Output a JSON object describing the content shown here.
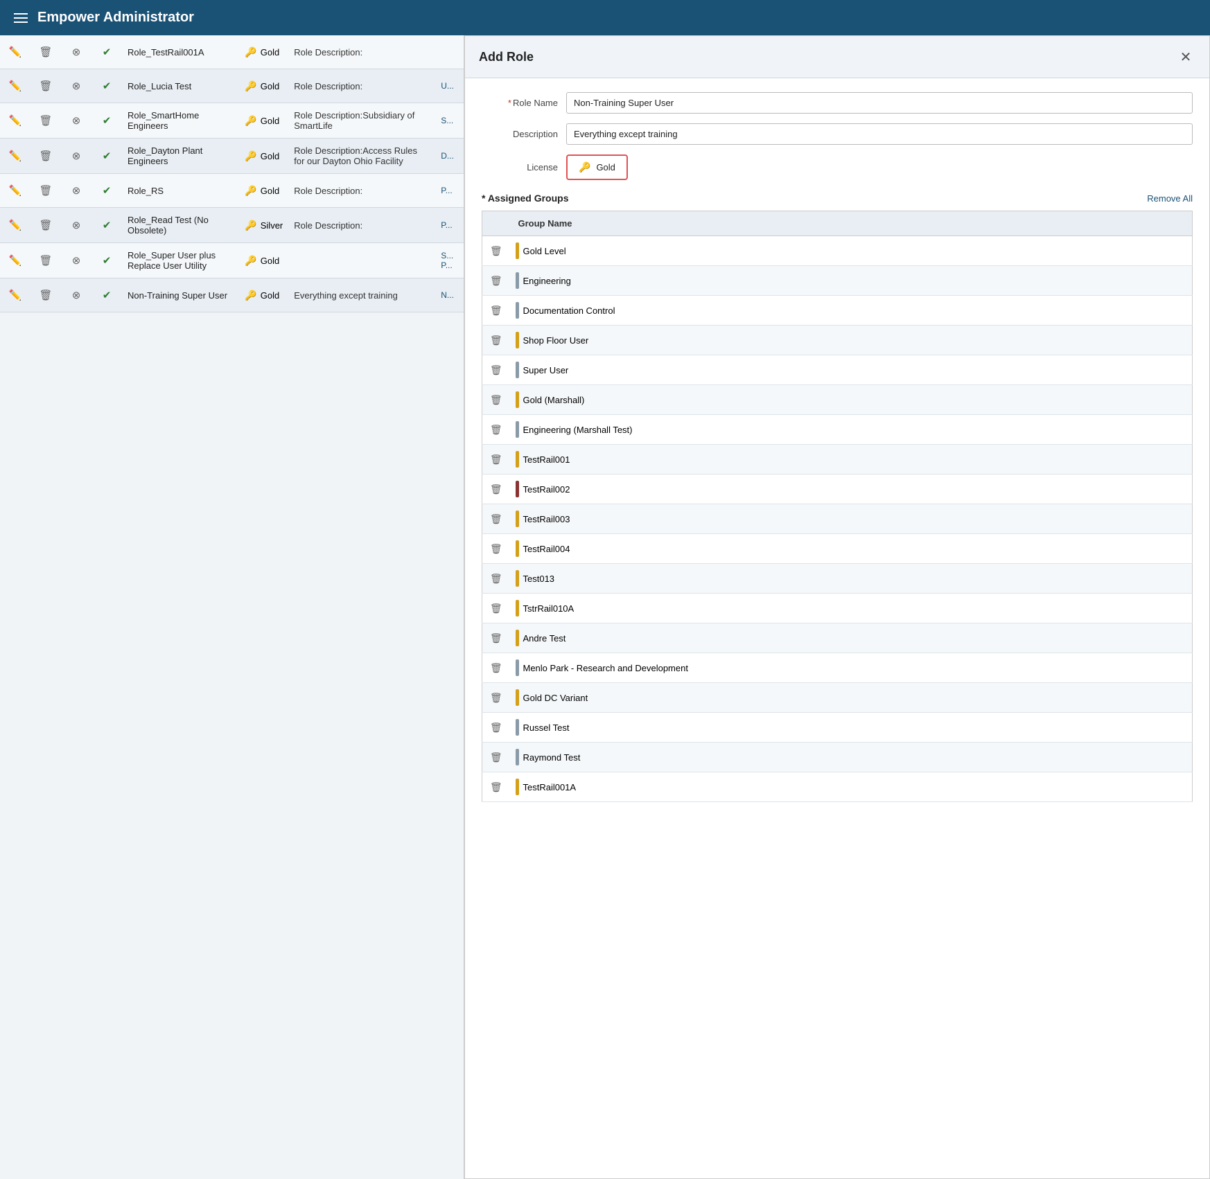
{
  "app": {
    "title": "Empower Administrator"
  },
  "roles_table": {
    "rows": [
      {
        "name": "Role_TestRail001A",
        "license": "Gold",
        "license_type": "gold",
        "description": "Role Description:",
        "extra": ""
      },
      {
        "name": "Role_Lucia Test",
        "license": "Gold",
        "license_type": "gold",
        "description": "Role Description:",
        "extra": "U..."
      },
      {
        "name": "Role_SmartHome Engineers",
        "license": "Gold",
        "license_type": "gold",
        "description": "Role Description:Subsidiary of SmartLife",
        "extra": "S..."
      },
      {
        "name": "Role_Dayton Plant Engineers",
        "license": "Gold",
        "license_type": "gold",
        "description": "Role Description:Access Rules for our Dayton Ohio Facility",
        "extra": "D..."
      },
      {
        "name": "Role_RS",
        "license": "Gold",
        "license_type": "gold",
        "description": "Role Description:",
        "extra": "P..."
      },
      {
        "name": "Role_Read Test (No Obsolete)",
        "license": "Silver",
        "license_type": "silver",
        "description": "Role Description:",
        "extra": "P..."
      },
      {
        "name": "Role_Super User plus Replace User Utility",
        "license": "Gold",
        "license_type": "gold",
        "description": "",
        "extra": "S... P..."
      },
      {
        "name": "Non-Training Super User",
        "license": "Gold",
        "license_type": "gold",
        "description": "Everything except training",
        "extra": "N..."
      }
    ]
  },
  "dialog": {
    "title": "Add Role",
    "close_label": "✕",
    "role_name_label": "Role Name",
    "role_name_value": "Non-Training Super User",
    "description_label": "Description",
    "description_value": "Everything except training",
    "license_label": "License",
    "license_value": "Gold",
    "assigned_groups_label": "* Assigned Groups",
    "remove_all_label": "Remove All",
    "group_name_col": "Group Name",
    "groups": [
      {
        "name": "Gold Level",
        "color": "#d4a017"
      },
      {
        "name": "Engineering",
        "color": "#8a9ba8"
      },
      {
        "name": "Documentation Control",
        "color": "#8a9ba8"
      },
      {
        "name": "Shop Floor User",
        "color": "#d4a017"
      },
      {
        "name": "Super User",
        "color": "#8a9ba8"
      },
      {
        "name": "Gold (Marshall)",
        "color": "#d4a017"
      },
      {
        "name": "Engineering (Marshall Test)",
        "color": "#8a9ba8"
      },
      {
        "name": "TestRail001",
        "color": "#d4a017"
      },
      {
        "name": "TestRail002",
        "color": "#8b3232"
      },
      {
        "name": "TestRail003",
        "color": "#d4a017"
      },
      {
        "name": "TestRail004",
        "color": "#d4a017"
      },
      {
        "name": "Test013",
        "color": "#d4a017"
      },
      {
        "name": "TstrRail010A",
        "color": "#d4a017"
      },
      {
        "name": "Andre Test",
        "color": "#d4a017"
      },
      {
        "name": "Menlo Park - Research and Development",
        "color": "#8a9ba8"
      },
      {
        "name": "Gold DC Variant",
        "color": "#d4a017"
      },
      {
        "name": "Russel Test",
        "color": "#8a9ba8"
      },
      {
        "name": "Raymond Test",
        "color": "#8a9ba8"
      },
      {
        "name": "TestRail001A",
        "color": "#d4a017"
      }
    ]
  }
}
